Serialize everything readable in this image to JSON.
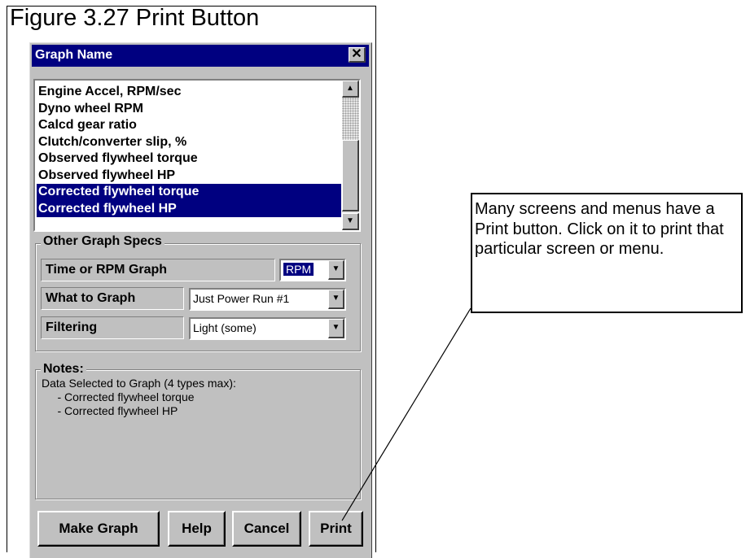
{
  "figure": {
    "title": "Figure 3.27  Print Button"
  },
  "dialog": {
    "title": "Graph Name",
    "close_symbol": "✕",
    "list": {
      "items": [
        {
          "label": "Engine Accel, RPM/sec",
          "selected": false
        },
        {
          "label": "Dyno wheel RPM",
          "selected": false
        },
        {
          "label": "Calcd gear ratio",
          "selected": false
        },
        {
          "label": "Clutch/converter slip, %",
          "selected": false
        },
        {
          "label": "Observed flywheel torque",
          "selected": false
        },
        {
          "label": "Observed flywheel HP",
          "selected": false
        },
        {
          "label": "Corrected flywheel torque",
          "selected": true
        },
        {
          "label": "Corrected flywheel HP",
          "selected": true
        }
      ],
      "scroll_up": "▲",
      "scroll_down": "▼"
    },
    "specs": {
      "group_label": "Other Graph Specs",
      "time_or_rpm": {
        "label": "Time or RPM Graph",
        "value": "RPM"
      },
      "what_to_graph": {
        "label": "What to Graph",
        "value": "Just Power Run #1"
      },
      "filtering": {
        "label": "Filtering",
        "value": "Light (some)"
      },
      "dropdown_arrow": "▼"
    },
    "notes": {
      "group_label": "Notes:",
      "line1": "Data Selected to Graph (4 types max):",
      "line2": "     - Corrected flywheel torque",
      "line3": "     - Corrected flywheel HP"
    },
    "buttons": {
      "make_graph": "Make Graph",
      "help": "Help",
      "cancel": "Cancel",
      "print": "Print"
    }
  },
  "callout": {
    "text": "Many screens and menus have a Print button.  Click on it to print that particular screen or menu."
  },
  "colors": {
    "title_bar": "#000080",
    "dialog_face": "#c0c0c0",
    "selection": "#000080"
  }
}
